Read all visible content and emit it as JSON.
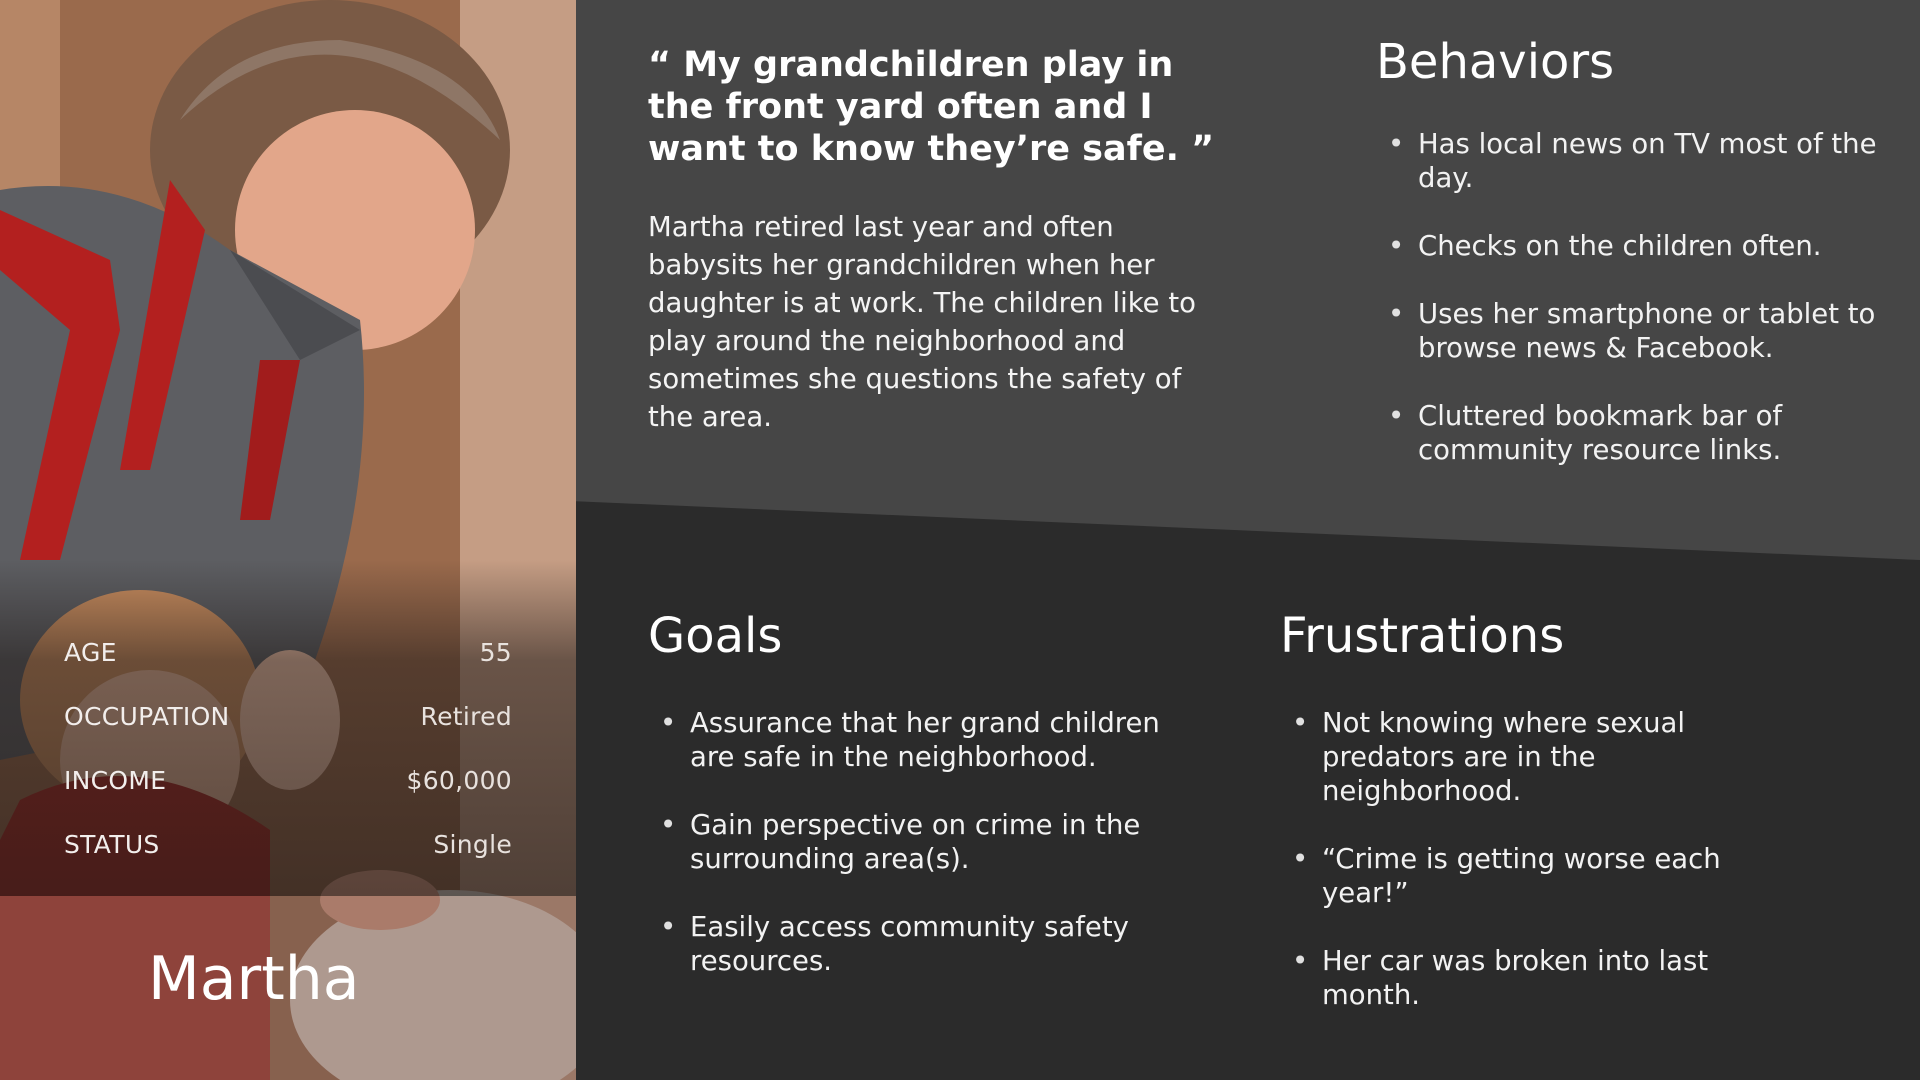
{
  "persona": {
    "name": "Martha",
    "photo": "grandmother-with-grandchild-photo",
    "details": [
      {
        "key": "AGE",
        "value": "55"
      },
      {
        "key": "OCCUPATION",
        "value": "Retired"
      },
      {
        "key": "INCOME",
        "value": "$60,000"
      },
      {
        "key": "STATUS",
        "value": "Single"
      }
    ]
  },
  "quote": "“ My grandchildren play in the front yard often and I want to know they’re safe. ”",
  "bio": "Martha retired last year and often babysits her grandchildren when her daughter is at work. The children like to play around the neighborhood and sometimes she questions the safety of the area.",
  "behaviors": {
    "title": "Behaviors",
    "items": [
      "Has local news on TV most of the day.",
      "Checks on the children often.",
      "Uses her smartphone or tablet to browse news & Facebook.",
      "Cluttered bookmark bar of community resource links."
    ]
  },
  "goals": {
    "title": "Goals",
    "items": [
      "Assurance that her grand children are safe in the neighborhood.",
      "Gain perspective on crime in the surrounding area(s).",
      "Easily access community safety resources."
    ]
  },
  "frustrations": {
    "title": "Frustrations",
    "items": [
      "Not knowing where sexual predators are in the neighborhood.",
      "“Crime is getting worse each year!”",
      "Her car was broken into last month."
    ]
  },
  "colors": {
    "upper_panel": "#464646",
    "lower_panel": "#2b2b2b",
    "apron_red": "#b3201f"
  }
}
